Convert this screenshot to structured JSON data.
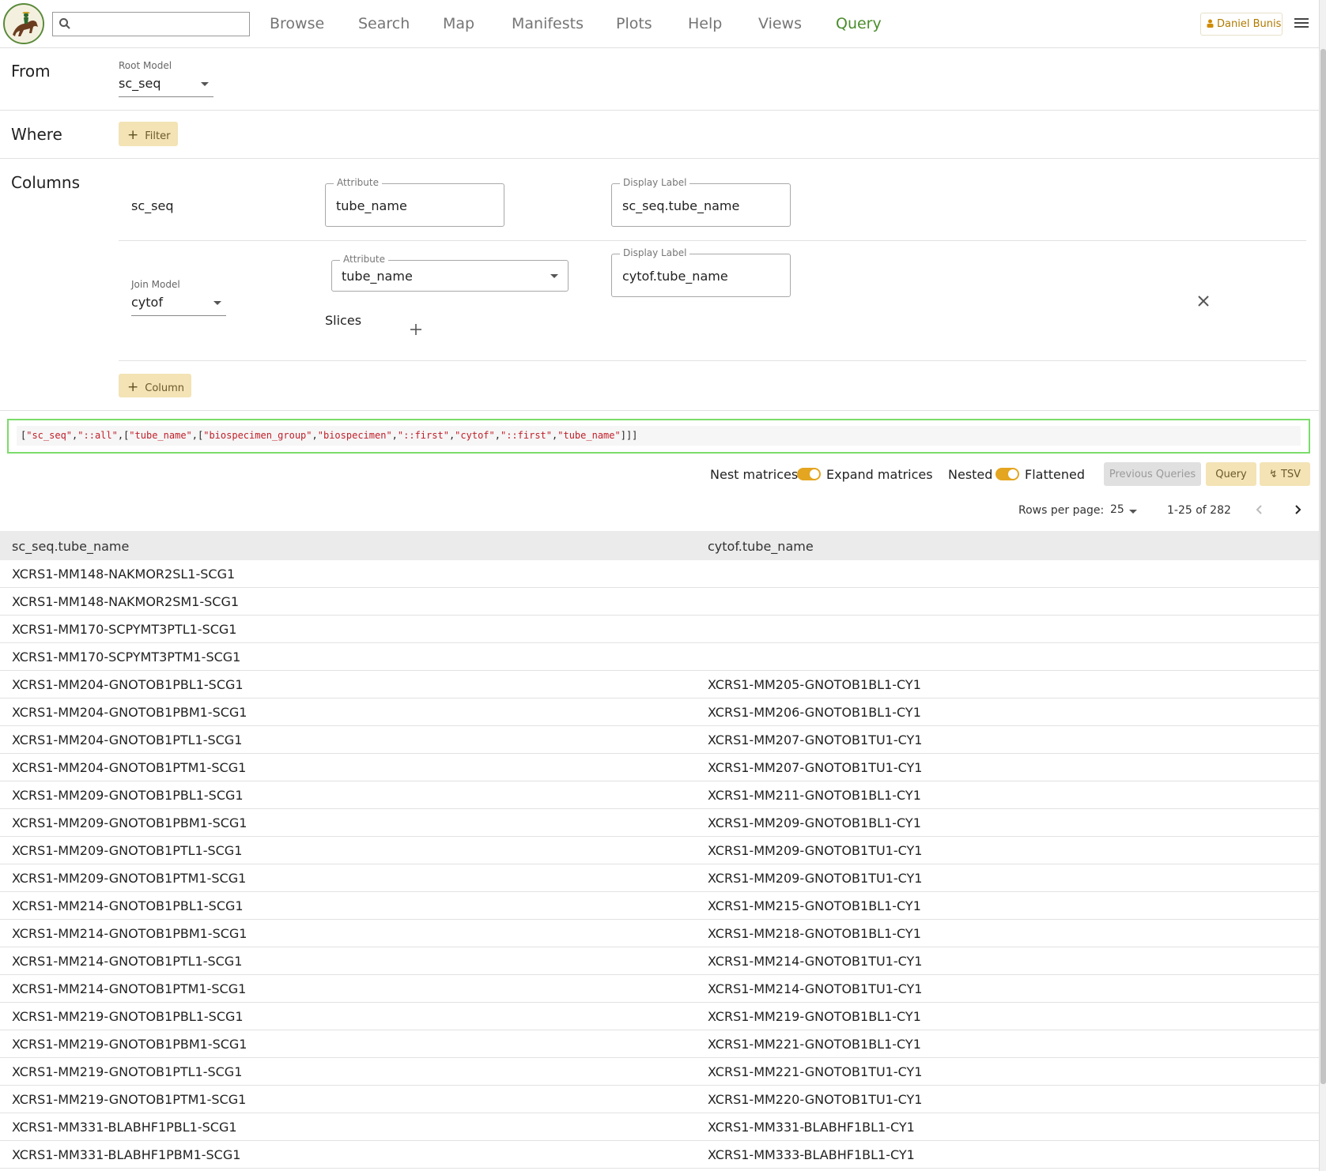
{
  "nav": {
    "items": [
      {
        "label": "Browse"
      },
      {
        "label": "Search"
      },
      {
        "label": "Map"
      },
      {
        "label": "Manifests"
      },
      {
        "label": "Plots"
      },
      {
        "label": "Help"
      },
      {
        "label": "Views"
      },
      {
        "label": "Query"
      }
    ],
    "active": "Query",
    "search_value": "",
    "user": "Daniel Bunis"
  },
  "from": {
    "title": "From",
    "root_model_label": "Root Model",
    "root_model_value": "sc_seq"
  },
  "where": {
    "title": "Where",
    "filter_button": "Filter"
  },
  "columns": {
    "title": "Columns",
    "first": {
      "model": "sc_seq",
      "attribute_label": "Attribute",
      "attribute_value": "tube_name",
      "display_label_label": "Display Label",
      "display_label_value": "sc_seq.tube_name"
    },
    "second": {
      "join_model_label": "Join Model",
      "join_model_value": "cytof",
      "attribute_label": "Attribute",
      "attribute_value": "tube_name",
      "display_label_label": "Display Label",
      "display_label_value": "cytof.tube_name",
      "slices_label": "Slices"
    },
    "add_column_button": "Column"
  },
  "query_json": {
    "parts": [
      "[",
      "\"sc_seq\"",
      ",",
      "\"::all\"",
      ",[",
      "\"tube_name\"",
      ",[",
      "\"biospecimen_group\"",
      ",",
      "\"biospecimen\"",
      ",",
      "\"::first\"",
      ",",
      "\"cytof\"",
      ",",
      "\"::first\"",
      ",",
      "\"tube_name\"",
      "]]]"
    ]
  },
  "controls": {
    "nest_matrices": "Nest matrices",
    "expand_matrices": "Expand matrices",
    "nested": "Nested",
    "flattened": "Flattened",
    "previous_queries": "Previous Queries",
    "query": "Query",
    "tsv": "TSV"
  },
  "pagination": {
    "rows_per_page_label": "Rows per page:",
    "rows_per_page": "25",
    "range": "1-25 of 282"
  },
  "table": {
    "headers": [
      "sc_seq.tube_name",
      "cytof.tube_name"
    ],
    "rows": [
      [
        "XCRS1-MM148-NAKMOR2SL1-SCG1",
        ""
      ],
      [
        "XCRS1-MM148-NAKMOR2SM1-SCG1",
        ""
      ],
      [
        "XCRS1-MM170-SCPYMT3PTL1-SCG1",
        ""
      ],
      [
        "XCRS1-MM170-SCPYMT3PTM1-SCG1",
        ""
      ],
      [
        "XCRS1-MM204-GNOTOB1PBL1-SCG1",
        "XCRS1-MM205-GNOTOB1BL1-CY1"
      ],
      [
        "XCRS1-MM204-GNOTOB1PBM1-SCG1",
        "XCRS1-MM206-GNOTOB1BL1-CY1"
      ],
      [
        "XCRS1-MM204-GNOTOB1PTL1-SCG1",
        "XCRS1-MM207-GNOTOB1TU1-CY1"
      ],
      [
        "XCRS1-MM204-GNOTOB1PTM1-SCG1",
        "XCRS1-MM207-GNOTOB1TU1-CY1"
      ],
      [
        "XCRS1-MM209-GNOTOB1PBL1-SCG1",
        "XCRS1-MM211-GNOTOB1BL1-CY1"
      ],
      [
        "XCRS1-MM209-GNOTOB1PBM1-SCG1",
        "XCRS1-MM209-GNOTOB1BL1-CY1"
      ],
      [
        "XCRS1-MM209-GNOTOB1PTL1-SCG1",
        "XCRS1-MM209-GNOTOB1TU1-CY1"
      ],
      [
        "XCRS1-MM209-GNOTOB1PTM1-SCG1",
        "XCRS1-MM209-GNOTOB1TU1-CY1"
      ],
      [
        "XCRS1-MM214-GNOTOB1PBL1-SCG1",
        "XCRS1-MM215-GNOTOB1BL1-CY1"
      ],
      [
        "XCRS1-MM214-GNOTOB1PBM1-SCG1",
        "XCRS1-MM218-GNOTOB1BL1-CY1"
      ],
      [
        "XCRS1-MM214-GNOTOB1PTL1-SCG1",
        "XCRS1-MM214-GNOTOB1TU1-CY1"
      ],
      [
        "XCRS1-MM214-GNOTOB1PTM1-SCG1",
        "XCRS1-MM214-GNOTOB1TU1-CY1"
      ],
      [
        "XCRS1-MM219-GNOTOB1PBL1-SCG1",
        "XCRS1-MM219-GNOTOB1BL1-CY1"
      ],
      [
        "XCRS1-MM219-GNOTOB1PBM1-SCG1",
        "XCRS1-MM221-GNOTOB1BL1-CY1"
      ],
      [
        "XCRS1-MM219-GNOTOB1PTL1-SCG1",
        "XCRS1-MM221-GNOTOB1TU1-CY1"
      ],
      [
        "XCRS1-MM219-GNOTOB1PTM1-SCG1",
        "XCRS1-MM220-GNOTOB1TU1-CY1"
      ],
      [
        "XCRS1-MM331-BLABHF1PBL1-SCG1",
        "XCRS1-MM331-BLABHF1BL1-CY1"
      ],
      [
        "XCRS1-MM331-BLABHF1PBM1-SCG1",
        "XCRS1-MM333-BLABHF1BL1-CY1"
      ]
    ]
  },
  "colors": {
    "accent_green": "#4a8d2c",
    "toggle_orange": "#e4a520",
    "button_yellow": "#f3e3b5",
    "query_border": "#7bdc6a",
    "json_string": "#c0202a"
  }
}
